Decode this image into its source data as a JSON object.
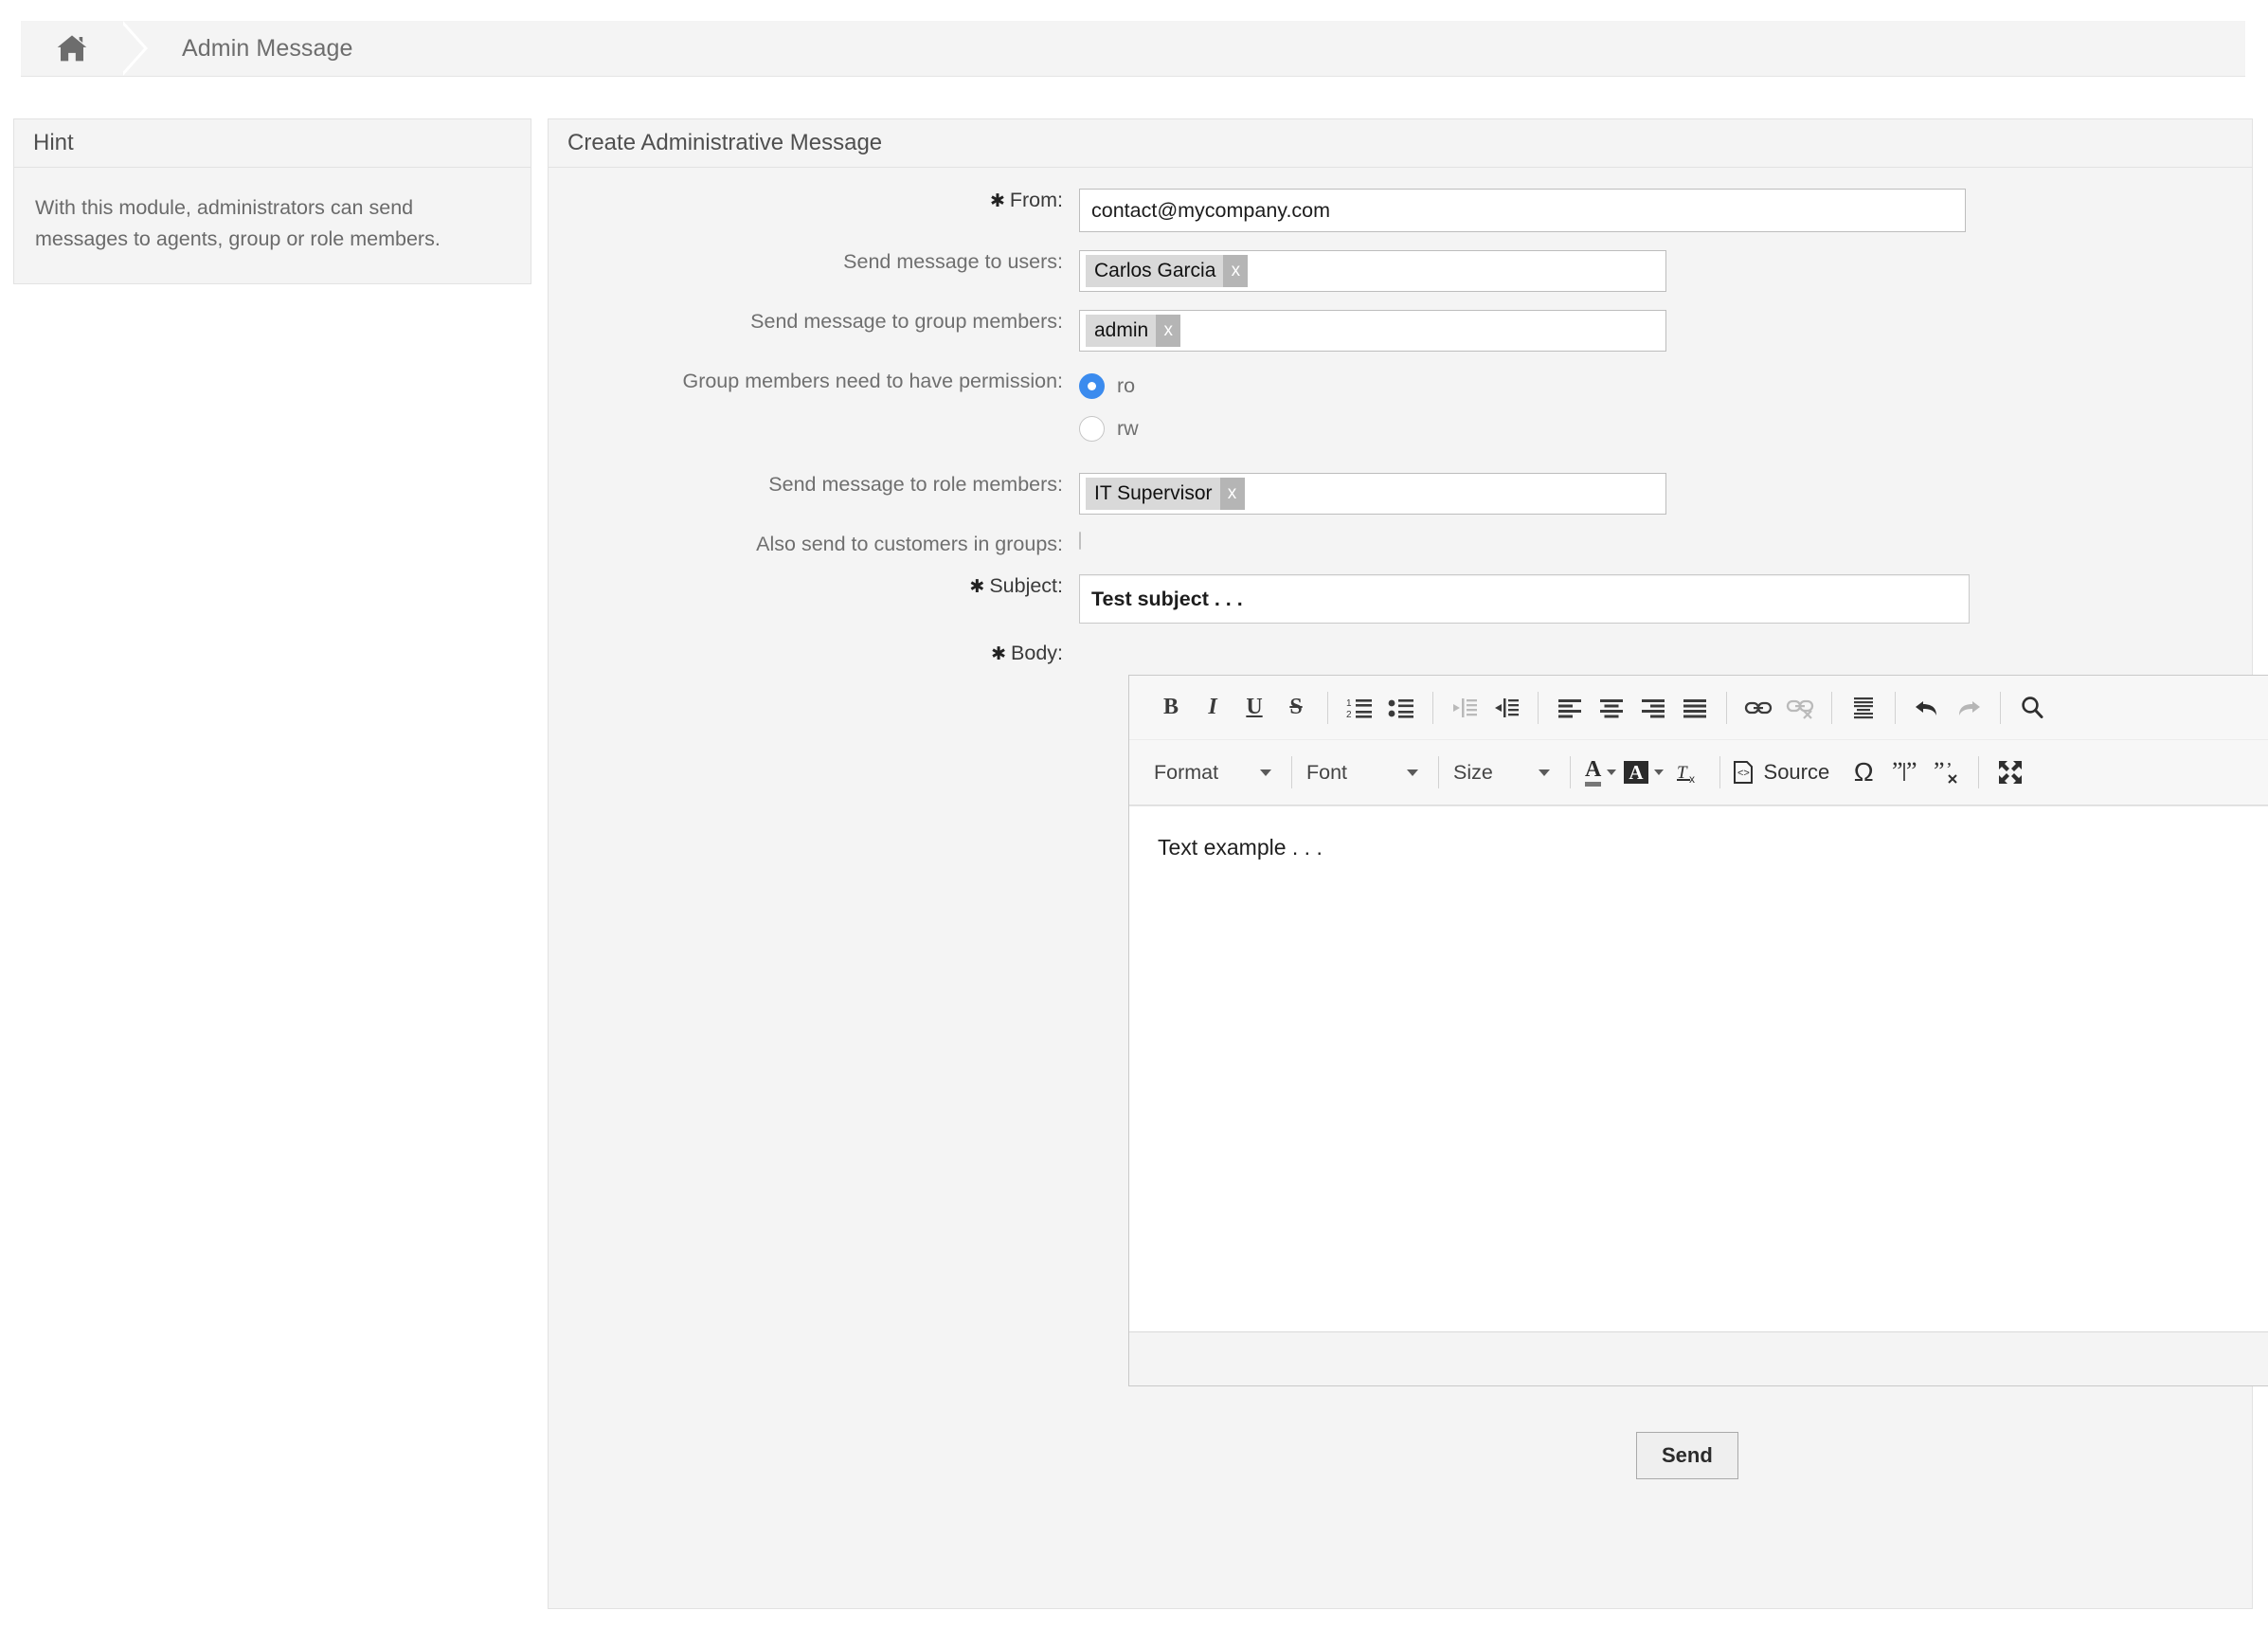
{
  "breadcrumb": {
    "home_icon": "home-icon",
    "title": "Admin Message"
  },
  "hint": {
    "header": "Hint",
    "text": "With this module, administrators can send messages to agents, group or role members."
  },
  "main": {
    "header": "Create Administrative Message",
    "fields": {
      "from": {
        "label": "From:",
        "required": true,
        "value": "contact@mycompany.com"
      },
      "users": {
        "label": "Send message to users:",
        "tokens": [
          {
            "label": "Carlos Garcia",
            "remove": "x"
          }
        ]
      },
      "group_members": {
        "label": "Send message to group members:",
        "tokens": [
          {
            "label": "admin",
            "remove": "x"
          }
        ]
      },
      "permission": {
        "label": "Group members need to have permission:",
        "options": [
          {
            "value": "ro",
            "label": "ro",
            "selected": true
          },
          {
            "value": "rw",
            "label": "rw",
            "selected": false
          }
        ]
      },
      "role_members": {
        "label": "Send message to role members:",
        "tokens": [
          {
            "label": "IT Supervisor",
            "remove": "x"
          }
        ]
      },
      "customers": {
        "label": "Also send to customers in groups:",
        "checked": false
      },
      "subject": {
        "label": "Subject:",
        "required": true,
        "value": "Test subject . . ."
      },
      "body": {
        "label": "Body:",
        "required": true,
        "value": "Text example . . ."
      }
    },
    "editor": {
      "toolbar_row1": [
        {
          "name": "bold-icon",
          "glyph": "B"
        },
        {
          "name": "italic-icon",
          "glyph": "I"
        },
        {
          "name": "underline-icon",
          "glyph": "U"
        },
        {
          "name": "strikethrough-icon",
          "glyph": "S"
        },
        {
          "name": "numbered-list-icon"
        },
        {
          "name": "bulleted-list-icon"
        },
        {
          "name": "outdent-icon",
          "disabled": true
        },
        {
          "name": "indent-icon"
        },
        {
          "name": "align-left-icon"
        },
        {
          "name": "align-center-icon"
        },
        {
          "name": "align-right-icon"
        },
        {
          "name": "align-justify-icon"
        },
        {
          "name": "link-icon"
        },
        {
          "name": "unlink-icon",
          "disabled": true
        },
        {
          "name": "blockquote-lines-icon"
        },
        {
          "name": "undo-icon"
        },
        {
          "name": "redo-icon",
          "disabled": true
        },
        {
          "name": "search-icon"
        }
      ],
      "format_label": "Format",
      "font_label": "Font",
      "size_label": "Size",
      "text_color_glyph": "A",
      "bg_color_glyph": "A",
      "remove_format_glyph": "Tx",
      "source_label": "Source",
      "special_char_glyph": "Ω",
      "quote_left_glyph": "quote-split-icon",
      "quote_remove_glyph": "quote-remove-icon",
      "maximize_glyph": "maximize-icon"
    },
    "send_button": "Send"
  }
}
